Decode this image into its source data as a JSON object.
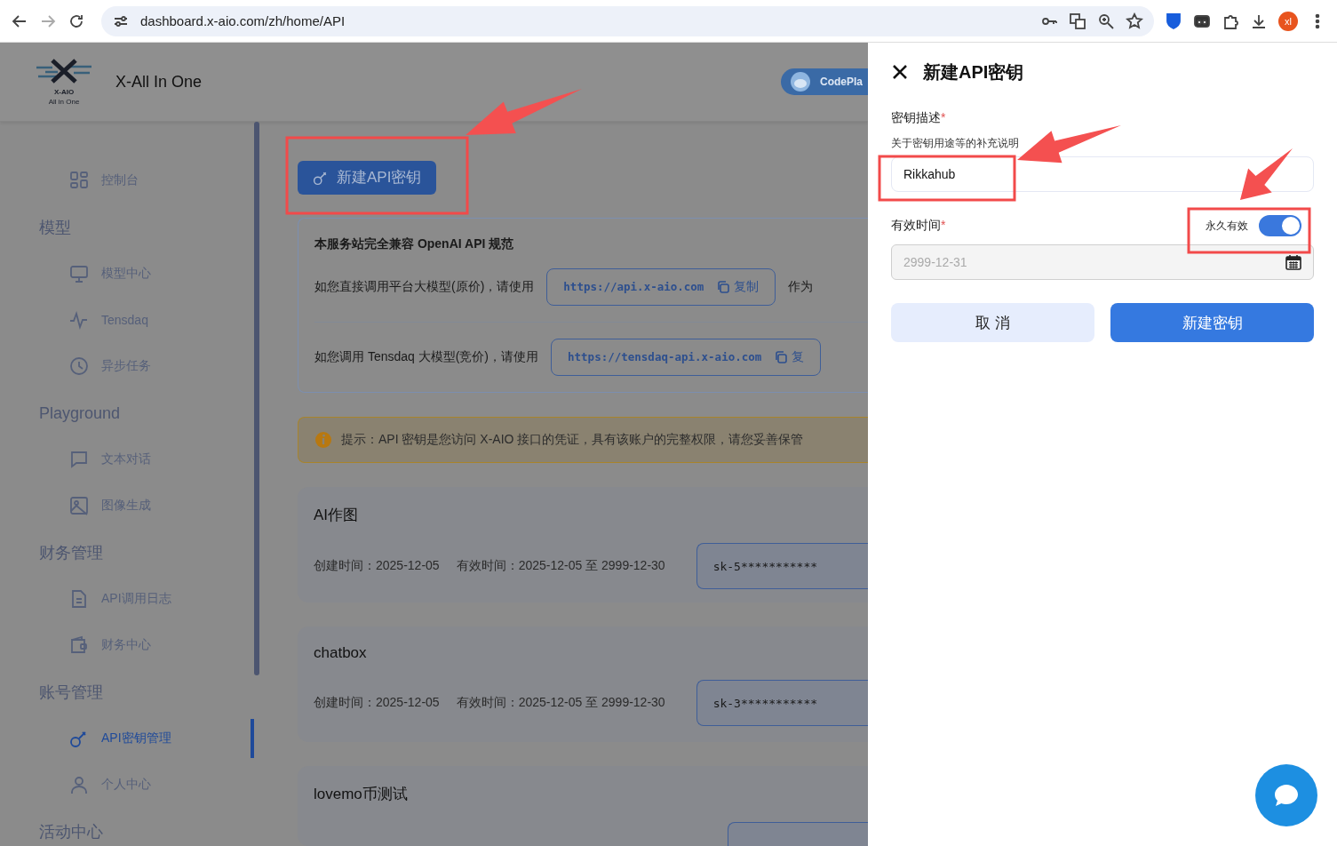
{
  "browser": {
    "url": "dashboard.x-aio.com/zh/home/API",
    "profile_initials": "xl"
  },
  "header": {
    "logo_text": "X-AIO",
    "logo_subtext": "All in One",
    "brand": "X-All In One",
    "promo_badge": "CodePla"
  },
  "sidebar": {
    "items": [
      {
        "kind": "item",
        "label": "控制台",
        "selected": false
      },
      {
        "kind": "section",
        "label": "模型"
      },
      {
        "kind": "item",
        "label": "模型中心",
        "selected": false
      },
      {
        "kind": "item",
        "label": "Tensdaq",
        "selected": false
      },
      {
        "kind": "item",
        "label": "异步任务",
        "selected": false
      },
      {
        "kind": "section",
        "label": "Playground"
      },
      {
        "kind": "item",
        "label": "文本对话",
        "selected": false
      },
      {
        "kind": "item",
        "label": "图像生成",
        "selected": false
      },
      {
        "kind": "section",
        "label": "财务管理"
      },
      {
        "kind": "item",
        "label": "API调用日志",
        "selected": false
      },
      {
        "kind": "item",
        "label": "财务中心",
        "selected": false
      },
      {
        "kind": "section",
        "label": "账号管理"
      },
      {
        "kind": "item",
        "label": "API密钥管理",
        "selected": true
      },
      {
        "kind": "item",
        "label": "个人中心",
        "selected": false
      },
      {
        "kind": "section",
        "label": "活动中心"
      }
    ]
  },
  "content": {
    "new_key_button": "新建API密钥",
    "info_card": {
      "title": "本服务站完全兼容 OpenAI API 规范",
      "endpoints": [
        {
          "label": "如您直接调用平台大模型(原价)，请使用",
          "url": "https://api.x-aio.com",
          "copy": "复制",
          "suffix": "作为"
        },
        {
          "label": "如您调用 Tensdaq 大模型(竞价)，请使用",
          "url": "https://tensdaq-api.x-aio.com",
          "copy": "复"
        }
      ]
    },
    "notice": "提示：API 密钥是您访问 X-AIO 接口的凭证，具有该账户的完整权限，请您妥善保管",
    "keys": [
      {
        "name": "AI作图",
        "created": "创建时间：2025-12-05",
        "validity": "有效时间：2025-12-05 至 2999-12-30",
        "key": "sk-5***********"
      },
      {
        "name": "chatbox",
        "created": "创建时间：2025-12-05",
        "validity": "有效时间：2025-12-05 至 2999-12-30",
        "key": "sk-3***********"
      },
      {
        "name": "lovemo币测试"
      }
    ]
  },
  "drawer": {
    "title": "新建API密钥",
    "description": {
      "label": "密钥描述",
      "required_mark": "*",
      "hint": "关于密钥用途等的补充说明",
      "value": "Rikkahub"
    },
    "expiry": {
      "label": "有效时间",
      "required_mark": "*",
      "permanent_label": "永久有效",
      "permanent_on": true,
      "date": "2999-12-31",
      "disabled": true
    },
    "buttons": [
      {
        "kind": "cancel",
        "label": "取 消"
      },
      {
        "kind": "submit",
        "label": "新建密钥"
      }
    ]
  }
}
